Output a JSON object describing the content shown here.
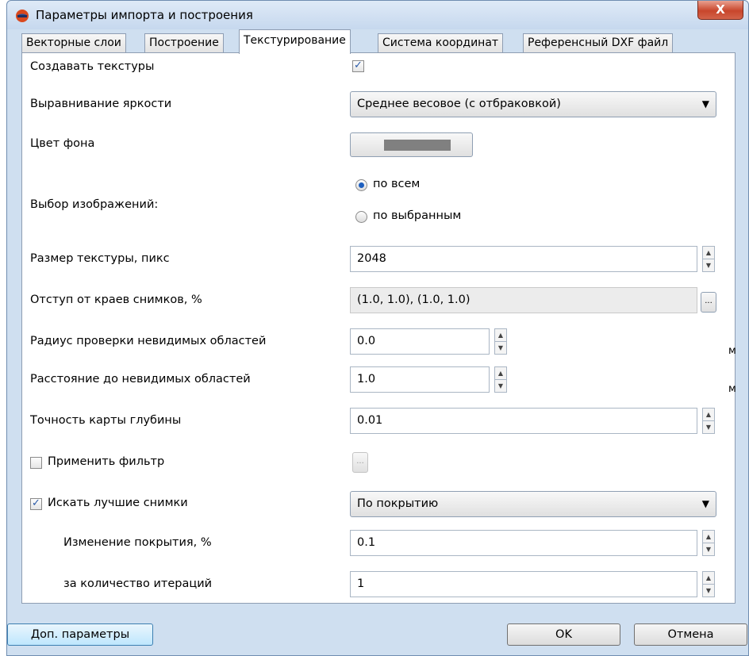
{
  "window": {
    "title": "Параметры импорта и построения",
    "close_label": "X"
  },
  "tabs": [
    {
      "label": "Векторные слои",
      "active": false
    },
    {
      "label": "Построение",
      "active": false
    },
    {
      "label": "Текстурирование",
      "active": true
    },
    {
      "label": "Система координат",
      "active": false
    },
    {
      "label": "Референсный DXF файл",
      "active": false
    }
  ],
  "form": {
    "create_textures_label": "Создавать текстуры",
    "create_textures_checked": true,
    "brightness_label": "Выравнивание яркости",
    "brightness_value": "Среднее весовое (с отбраковкой)",
    "bg_color_label": "Цвет фона",
    "bg_color_value": "#808080",
    "image_selection_label": "Выбор изображений:",
    "radio_all": "по всем",
    "radio_selected": "по выбранным",
    "texture_size_label": "Размер текстуры, пикс",
    "texture_size_value": "2048",
    "edge_offset_label": "Отступ от краев снимков, %",
    "edge_offset_value": "(1.0, 1.0), (1.0, 1.0)",
    "invisible_radius_label": "Радиус проверки невидимых областей",
    "invisible_radius_value": "0.0",
    "invisible_radius_unit": "м",
    "invisible_distance_label": "Расстояние до невидимых областей",
    "invisible_distance_value": "1.0",
    "invisible_distance_unit": "м",
    "depth_accuracy_label": "Точность карты глубины",
    "depth_accuracy_value": "0.01",
    "apply_filter_label": "Применить фильтр",
    "apply_filter_checked": false,
    "best_images_label": "Искать лучшие снимки",
    "best_images_checked": true,
    "best_images_value": "По покрытию",
    "coverage_change_label": "Изменение покрытия, %",
    "coverage_change_value": "0.1",
    "iterations_label": "за количество итераций",
    "iterations_value": "1"
  },
  "buttons": {
    "more_params": "Доп. параметры",
    "ok": "OK",
    "cancel": "Отмена",
    "dots": "..."
  }
}
